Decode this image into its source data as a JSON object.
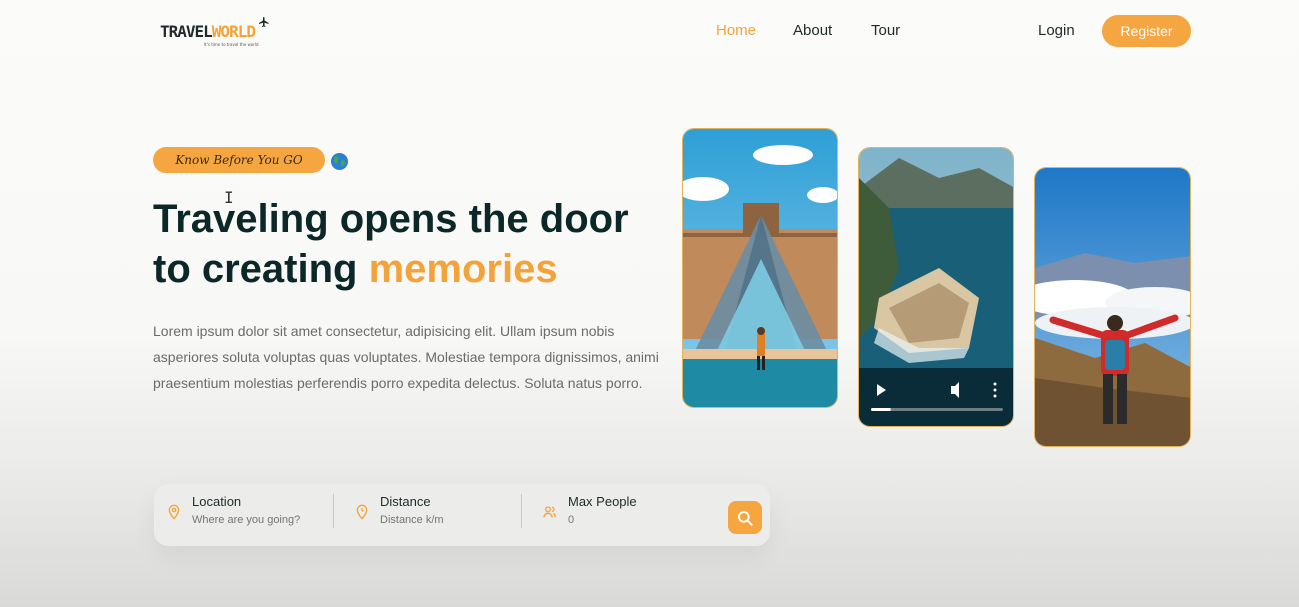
{
  "header": {
    "logo": {
      "part1": "TRAVEL",
      "part2": "WORLD",
      "tagline": "It's time to travel the world"
    },
    "nav": [
      {
        "label": "Home",
        "active": true
      },
      {
        "label": "About",
        "active": false
      },
      {
        "label": "Tour",
        "active": false
      }
    ],
    "login_label": "Login",
    "register_label": "Register"
  },
  "hero": {
    "badge": "Know Before You GO",
    "headline_part1": "Traveling opens the door",
    "headline_part2": "to creating ",
    "headline_highlight": "memories",
    "paragraph_lines": [
      "Lorem ipsum dolor sit amet consectetur, adipisicing elit. Ullam ipsum nobis",
      "asperiores soluta voluptas quas voluptates. Molestiae tempora dignissimos, animi",
      "praesentium molestias perferendis porro expedita delectus. Soluta natus porro."
    ],
    "video_progress_percent": 15
  },
  "search": {
    "location": {
      "label": "Location",
      "placeholder": "Where are you going?",
      "icon": "map-pin-icon"
    },
    "distance": {
      "label": "Distance",
      "placeholder": "Distance k/m",
      "icon": "map-marker-time-icon"
    },
    "max_people": {
      "label": "Max People",
      "placeholder": "0",
      "icon": "group-icon"
    },
    "button_icon": "search-icon"
  },
  "colors": {
    "accent": "#f5a640",
    "heading": "#0b2727",
    "body_text": "#6b6b6b"
  }
}
